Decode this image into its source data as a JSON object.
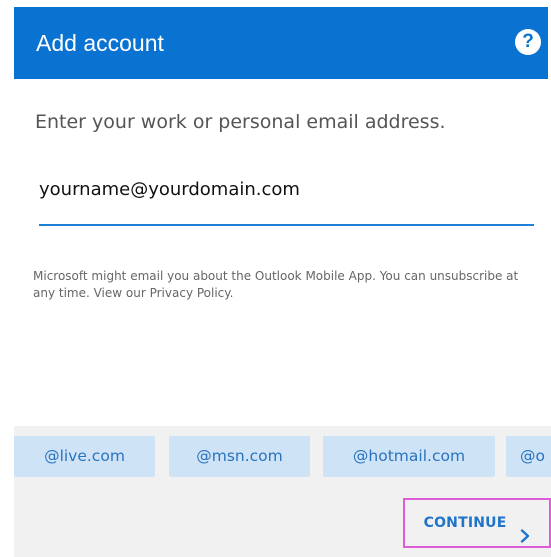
{
  "header": {
    "title": "Add account",
    "help_icon_label": "?",
    "background_color": "#0a73d1"
  },
  "main": {
    "prompt": "Enter your work or personal email address.",
    "email_value": "yourname@yourdomain.com",
    "notice": "Microsoft might email you about the Outlook Mobile App. You can unsubscribe at any time. View our Privacy Policy."
  },
  "domain_suggestions": [
    {
      "label": "@live.com"
    },
    {
      "label": "@msn.com"
    },
    {
      "label": "@hotmail.com"
    },
    {
      "label": "@o"
    }
  ],
  "footer": {
    "continue_label": "CONTINUE",
    "continue_icon": "chevron-right-icon",
    "highlight_color": "#e05bd9"
  },
  "icons": {
    "help": "help-icon",
    "continue": "chevron-right-icon"
  },
  "colors": {
    "accent": "#0a73d1",
    "chip_background": "#cfe3f7",
    "chip_text": "#2874bd",
    "input_underline": "#1e7fd8"
  }
}
